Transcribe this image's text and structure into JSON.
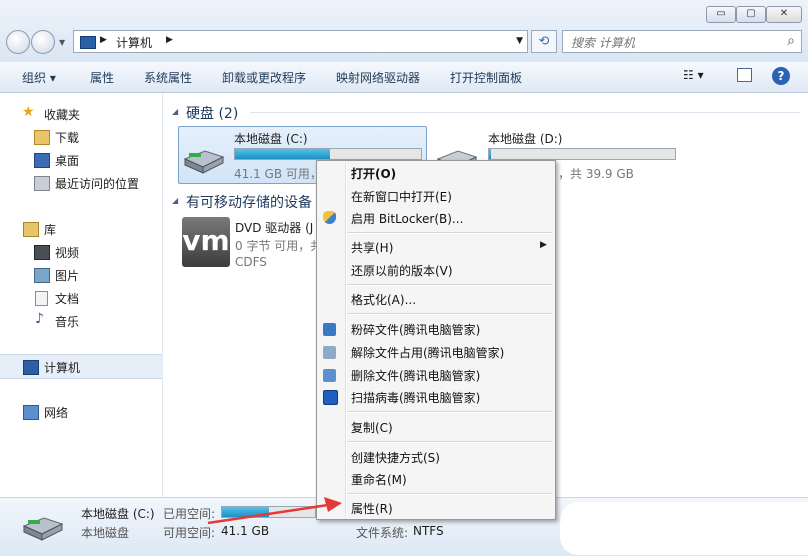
{
  "window": {
    "controls": {
      "minimize": "▭",
      "maximize": "▢",
      "close": "✕"
    }
  },
  "address": {
    "path": "计算机"
  },
  "search": {
    "placeholder": "搜索 计算机"
  },
  "toolbar": {
    "organize": "组织 ▾",
    "properties": "属性",
    "system_properties": "系统属性",
    "uninstall": "卸载或更改程序",
    "map_drive": "映射网络驱动器",
    "control_panel": "打开控制面板"
  },
  "nav": {
    "favorites": "收藏夹",
    "downloads": "下载",
    "desktop": "桌面",
    "recent": "最近访问的位置",
    "libraries": "库",
    "videos": "视频",
    "pictures": "图片",
    "documents": "文档",
    "music": "音乐",
    "computer": "计算机",
    "network": "网络"
  },
  "content": {
    "hard_disk_group": "硬盘 (2)",
    "removable_group": "有可移动存储的设备",
    "drive_c": {
      "name": "本地磁盘 (C:)",
      "free_text": "41.1 GB 可用，",
      "used_fraction": 0.51
    },
    "drive_d": {
      "name": "本地磁盘 (D:)",
      "free_text": "，共 39.9 GB",
      "used_fraction": 0.01
    },
    "dvd": {
      "name": "DVD 驱动器 (J",
      "free_text": "0 字节 可用，共",
      "fs": "CDFS",
      "icon_text": "vm"
    }
  },
  "status": {
    "name": "本地磁盘 (C:)",
    "type": "本地磁盘",
    "used_label": "已用空间:",
    "free_label": "可用空间:",
    "free_value": "41.1 GB",
    "fs_label": "文件系统:",
    "fs_value": "NTFS"
  },
  "context_menu": {
    "open": "打开(O)",
    "open_new_window": "在新窗口中打开(E)",
    "bitlocker": "启用 BitLocker(B)...",
    "share": "共享(H)",
    "restore": "还原以前的版本(V)",
    "format": "格式化(A)...",
    "shred": "粉碎文件(腾讯电脑管家)",
    "unlock": "解除文件占用(腾讯电脑管家)",
    "delete": "删除文件(腾讯电脑管家)",
    "scan": "扫描病毒(腾讯电脑管家)",
    "copy": "复制(C)",
    "shortcut": "创建快捷方式(S)",
    "rename": "重命名(M)",
    "properties": "属性(R)"
  },
  "colors": {
    "accent": "#2c62b6",
    "bar_fill": "#2aa3d6",
    "arrow": "#e53935"
  }
}
